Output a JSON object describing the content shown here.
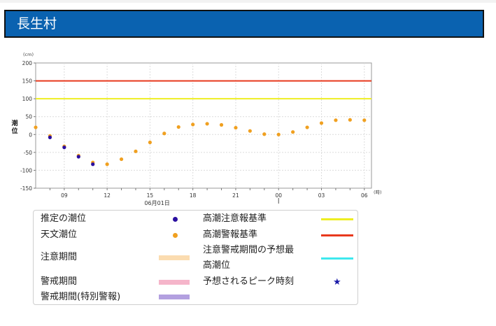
{
  "page_title": "長生村",
  "chart_data": {
    "type": "scatter",
    "ylabel": "潮位",
    "y_unit": "(cm)",
    "x_unit": "(時)",
    "date_label": "06月01日",
    "ylim": [
      -150,
      200
    ],
    "yticks": [
      200,
      150,
      100,
      50,
      0,
      -50,
      -100,
      -150
    ],
    "xticks": [
      "09",
      "12",
      "15",
      "18",
      "21",
      "00",
      "03",
      "06"
    ],
    "grid": true,
    "reference_lines": [
      {
        "name": "高潮警報基準",
        "value": 150,
        "color": "#e8391d"
      },
      {
        "name": "高潮注意報基準",
        "value": 100,
        "color": "#eeee22"
      }
    ],
    "series": [
      {
        "name": "天文潮位",
        "color": "#f0a020",
        "x": [
          "2025-06-01 07:00",
          "2025-06-01 08:00",
          "2025-06-01 09:00",
          "2025-06-01 10:00",
          "2025-06-01 11:00",
          "2025-06-01 12:00",
          "2025-06-01 13:00",
          "2025-06-01 14:00",
          "2025-06-01 15:00",
          "2025-06-01 16:00",
          "2025-06-01 17:00",
          "2025-06-01 18:00",
          "2025-06-01 19:00",
          "2025-06-01 20:00",
          "2025-06-01 21:00",
          "2025-06-01 22:00",
          "2025-06-01 23:00",
          "2025-06-02 00:00",
          "2025-06-02 01:00",
          "2025-06-02 02:00",
          "2025-06-02 03:00",
          "2025-06-02 04:00",
          "2025-06-02 05:00",
          "2025-06-02 06:00"
        ],
        "values": [
          20,
          -4,
          -33,
          -59,
          -78,
          -83,
          -69,
          -47,
          -22,
          3,
          21,
          28,
          30,
          27,
          19,
          10,
          1,
          0,
          7,
          20,
          32,
          40,
          41,
          40
        ]
      },
      {
        "name": "推定の潮位",
        "color": "#2a0fa0",
        "x": [
          "2025-06-01 08:00",
          "2025-06-01 09:00",
          "2025-06-01 10:00",
          "2025-06-01 11:00"
        ],
        "values": [
          -8,
          -36,
          -62,
          -83
        ]
      }
    ]
  },
  "legend": {
    "estimated_tide": "推定の潮位",
    "astronomical_tide": "天文潮位",
    "caution_period": "注意期間",
    "warning_period": "警戒期間",
    "special_warning_period": "警戒期間(特別警報)",
    "advisory_threshold": "高潮注意報基準",
    "warning_threshold": "高潮警報基準",
    "forecast_max_line1": "注意警戒期間の予想最",
    "forecast_max_line2": "高潮位",
    "peak_time": "予想されるピーク時刻",
    "colors": {
      "caution": "#fbdcb0",
      "warning": "#f5b5ca",
      "special": "#b3a0e0",
      "advisory_line": "#eeee22",
      "warning_line": "#e8391d",
      "forecast_line": "#3ee8ee",
      "star": "#1a1aa8"
    }
  }
}
